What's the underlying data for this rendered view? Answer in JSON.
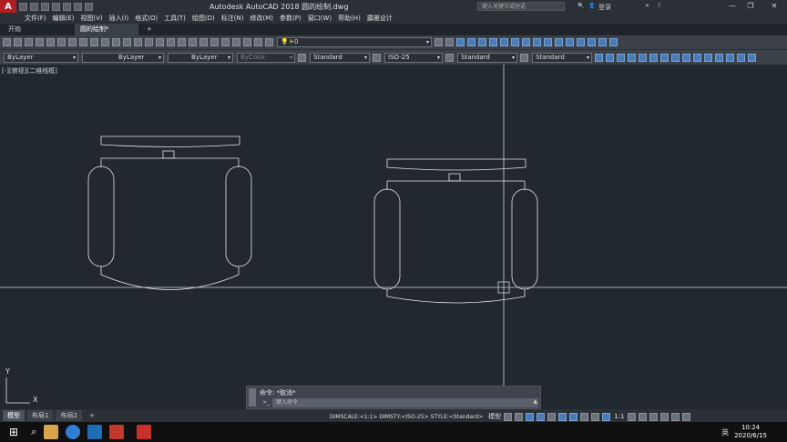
{
  "app": {
    "title": "Autodesk AutoCAD 2018    圆的绘制.dwg",
    "logo_letter": "A",
    "search_placeholder": "键入关键字或短语",
    "signin_label": "登录"
  },
  "menu": [
    "文件(F)",
    "编辑(E)",
    "视图(V)",
    "插入(I)",
    "格式(O)",
    "工具(T)",
    "绘图(D)",
    "标注(N)",
    "修改(M)",
    "参数(P)",
    "窗口(W)",
    "帮助(H)",
    "露雅设计"
  ],
  "tabs": [
    {
      "label": "开始",
      "active": false
    },
    {
      "label": "圆的绘制*",
      "active": true
    }
  ],
  "tabs_add": "+",
  "properties": {
    "color_value": "ByLayer",
    "linetype_value": "ByLayer",
    "lineweight_value": "ByLayer",
    "plotstyle_value": "ByColor",
    "text_style": "Standard",
    "dim_style": "ISO-25",
    "table_style": "Standard",
    "mleader_style": "Standard",
    "layer_value": "0"
  },
  "viewport_label": "[-][俯视][二维线框]",
  "ucs": {
    "x_label": "X",
    "y_label": "Y"
  },
  "command": {
    "history": "命令: *取消*",
    "placeholder": "键入命令"
  },
  "layout_tabs": [
    {
      "label": "模型",
      "active": true
    },
    {
      "label": "布局1",
      "active": false
    },
    {
      "label": "布局2",
      "active": false
    }
  ],
  "status": {
    "dim_info": "DIMSCALE:<1:1> DIMSTY:<ISO-25> STYLE:<Standard>",
    "model_label": "模型",
    "scale": "1:1"
  },
  "taskbar": {
    "time": "10:24",
    "date": "2020/6/15",
    "ime": "英"
  }
}
